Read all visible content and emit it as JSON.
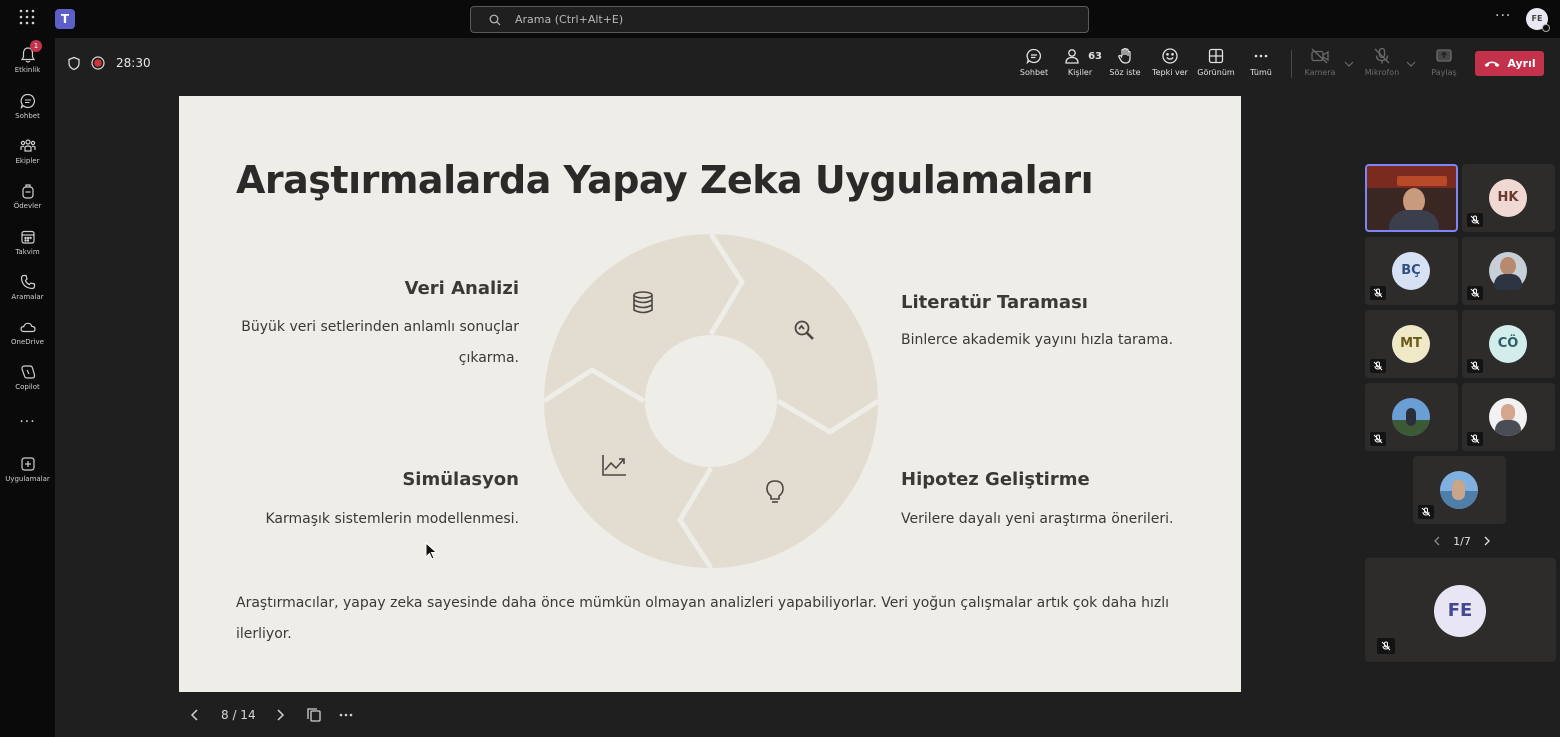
{
  "topbar": {
    "search_placeholder": "Arama (Ctrl+Alt+E)",
    "more": "···",
    "user_initials": "FE"
  },
  "rail": {
    "items": [
      {
        "label": "Etkinlik",
        "icon": "bell-icon",
        "badge": "1"
      },
      {
        "label": "Sohbet",
        "icon": "chat-icon"
      },
      {
        "label": "Ekipler",
        "icon": "teams-icon"
      },
      {
        "label": "Ödevler",
        "icon": "backpack-icon"
      },
      {
        "label": "Takvim",
        "icon": "calendar-icon"
      },
      {
        "label": "Aramalar",
        "icon": "phone-icon"
      },
      {
        "label": "OneDrive",
        "icon": "cloud-icon"
      },
      {
        "label": "Copilot",
        "icon": "copilot-icon"
      },
      {
        "label": "···",
        "icon": "more-icon"
      },
      {
        "label": "Uygulamalar",
        "icon": "add-apps-icon"
      }
    ]
  },
  "meeting": {
    "timer": "28:30",
    "participant_count": "63",
    "toolbar": {
      "chat": "Sohbet",
      "people": "Kişiler",
      "raise_hand": "Söz iste",
      "react": "Tepki ver",
      "view": "Görünüm",
      "more": "Tümü",
      "camera": "Kamera",
      "mic": "Mikrofon",
      "share": "Paylaş"
    },
    "leave": "Ayrıl"
  },
  "slide": {
    "title": "Araştırmalarda Yapay Zeka Uygulamaları",
    "features": [
      {
        "title": "Veri Analizi",
        "desc": "Büyük veri setlerinden anlamlı sonuçlar çıkarma."
      },
      {
        "title": "Literatür Taraması",
        "desc": "Binlerce akademik yayını hızla tarama."
      },
      {
        "title": "Simülasyon",
        "desc": "Karmaşık sistemlerin modellenmesi."
      },
      {
        "title": "Hipotez Geliştirme",
        "desc": "Verilere dayalı yeni araştırma önerileri."
      }
    ],
    "summary": "Araştırmacılar, yapay zeka sayesinde daha önce mümkün olmayan analizleri yapabiliyorlar. Veri yoğun çalışmalar artık çok daha hızlı ilerliyor.",
    "position": "8 / 14"
  },
  "gallery": {
    "participants": [
      {
        "initials": "HK",
        "color": "#f0d9d2",
        "text_color": "#6a3a30"
      },
      {
        "initials": "BÇ",
        "color": "#d6e2f3",
        "text_color": "#2f4f82"
      },
      {
        "initials": "MT",
        "color": "#efe9c8",
        "text_color": "#6b5a1c"
      },
      {
        "initials": "CÖ",
        "color": "#d3ecec",
        "text_color": "#2b5e63"
      }
    ],
    "page": "1/7",
    "self_initials": "FE"
  },
  "colors": {
    "leave": "#c4314b",
    "slide_bg": "#efede8",
    "ring": "#e3ddd1",
    "active_speaker": "#7f85f5"
  }
}
